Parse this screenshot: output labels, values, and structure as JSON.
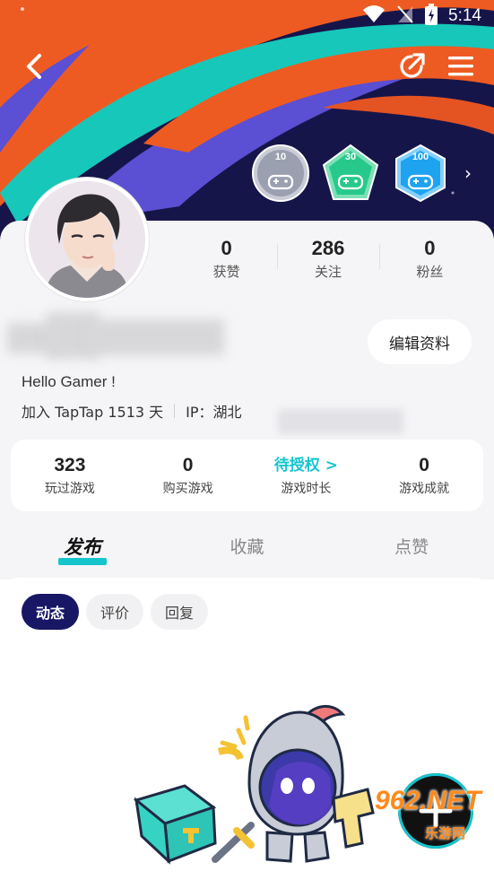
{
  "status_bar": {
    "time": "5:14"
  },
  "theme": {
    "accent": "#15c5ce",
    "chip_active": "#171766",
    "banner_bg": "#16154a",
    "orange": "#ee5b22",
    "teal": "#17c7b9",
    "purple": "#5b4fd3"
  },
  "header": {
    "back_icon": "chevron-left-icon",
    "share_icon": "share-icon",
    "menu_icon": "menu-icon",
    "badges": [
      {
        "number": "10",
        "color": "#9aa0b0"
      },
      {
        "number": "30",
        "color": "#27c98a"
      },
      {
        "number": "100",
        "color": "#1ea3f0"
      }
    ]
  },
  "profile": {
    "stats": [
      {
        "value": "0",
        "label": "获赞"
      },
      {
        "value": "286",
        "label": "关注"
      },
      {
        "value": "0",
        "label": "粉丝"
      }
    ],
    "edit_button": "编辑资料",
    "bio": "Hello Gamer !",
    "join_text": "加入 TapTap 1513 天",
    "ip_text": "IP：湖北"
  },
  "game_stats": [
    {
      "value": "323",
      "label": "玩过游戏"
    },
    {
      "value": "0",
      "label": "购买游戏"
    },
    {
      "value": "待授权 >",
      "label": "游戏时长"
    },
    {
      "value": "0",
      "label": "游戏成就"
    }
  ],
  "tabs": [
    "发布",
    "收藏",
    "点赞"
  ],
  "chips": [
    "动态",
    "评价",
    "回复"
  ],
  "fab": {
    "icon": "plus-icon"
  },
  "watermark": {
    "brand": "962.NET",
    "sub": "乐游网"
  }
}
